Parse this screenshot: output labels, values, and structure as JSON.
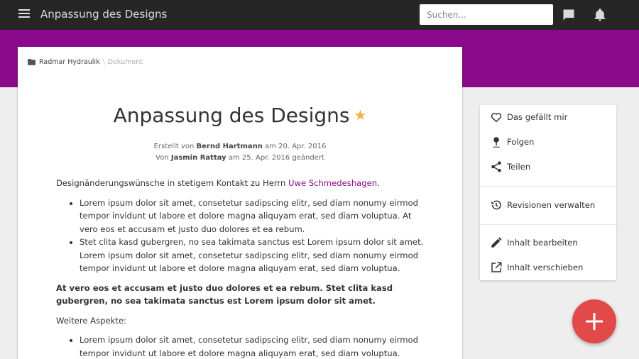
{
  "header": {
    "title": "Anpassung des Designs",
    "search_placeholder": "Suchen...",
    "icons": [
      "menu-icon",
      "chat-icon",
      "bell-icon"
    ]
  },
  "colors": {
    "accent": "#8b0a8c",
    "topbar": "#262626",
    "fab": "#e24a4a",
    "star": "#f0b04a"
  },
  "breadcrumb": {
    "items": [
      "Radmar Hydraulik",
      "Dokument"
    ]
  },
  "document": {
    "title": "Anpassung des Designs",
    "meta": {
      "created_prefix": "Erstellt von",
      "created_by": "Bernd Hartmann",
      "created_on": "am 20. Apr. 2016",
      "changed_prefix": "Von",
      "changed_by": "Jasmin Rattay",
      "changed_on": "am 25. Apr. 2016 geändert"
    },
    "intro_text": "Designänderungswünsche in stetigem Kontakt zu Herrn ",
    "intro_link": "Uwe Schmedeshagen",
    "intro_end": ".",
    "list1": [
      "Lorem ipsum dolor sit amet, consetetur sadipscing elitr, sed diam nonumy eirmod tempor invidunt ut labore et dolore magna aliquyam erat, sed diam voluptua. At vero eos et accusam et justo duo dolores et ea rebum.",
      "Stet clita kasd gubergren, no sea takimata sanctus est Lorem ipsum dolor sit amet. Lorem ipsum dolor sit amet, consetetur sadipscing elitr, sed diam nonumy eirmod tempor invidunt ut labore et dolore magna aliquyam erat, sed diam voluptua."
    ],
    "bold_paragraph": "At vero eos et accusam et justo duo dolores et ea rebum. Stet clita kasd gubergren, no sea takimata sanctus est Lorem ipsum dolor sit amet.",
    "subheading": "Weitere Aspekte:",
    "list2": [
      "Lorem ipsum dolor sit amet, consetetur sadipscing elitr, sed diam nonumy eirmod tempor invidunt ut labore et dolore magna aliquyam erat, sed diam voluptua."
    ]
  },
  "sidebar": {
    "like": "Das gefällt mir",
    "follow": "Folgen",
    "share": "Teilen",
    "revisions": "Revisionen verwalten",
    "edit": "Inhalt bearbeiten",
    "move": "Inhalt verschieben"
  },
  "fab": {
    "icon": "plus-icon"
  }
}
